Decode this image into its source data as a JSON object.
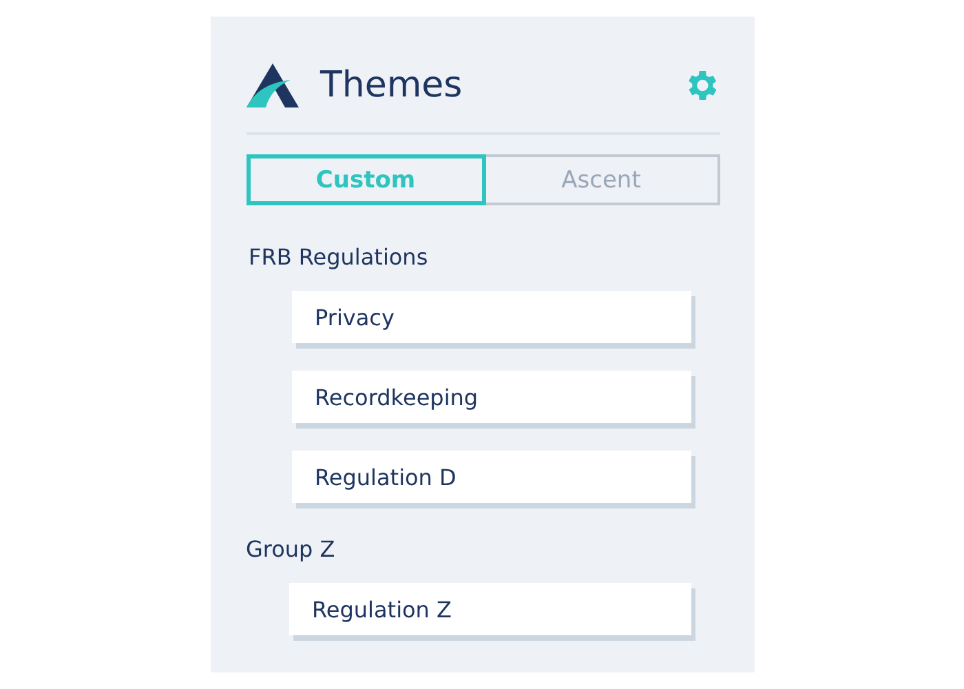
{
  "header": {
    "title": "Themes"
  },
  "tabs": [
    {
      "label": "Custom",
      "selected": true
    },
    {
      "label": "Ascent",
      "selected": false
    }
  ],
  "groups": [
    {
      "label": "FRB Regulations",
      "items": [
        "Privacy",
        "Recordkeeping",
        "Regulation D"
      ]
    },
    {
      "label": "Group Z",
      "items": [
        "Regulation Z"
      ]
    }
  ]
}
